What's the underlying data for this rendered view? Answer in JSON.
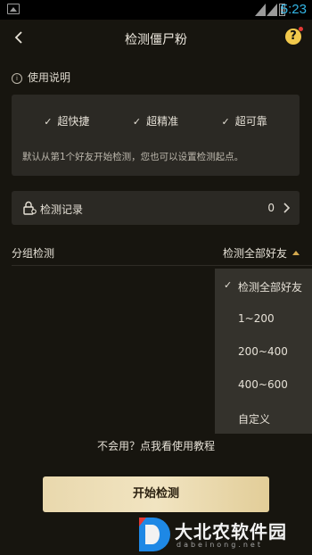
{
  "status_bar": {
    "time": "5:23"
  },
  "nav": {
    "title": "检测僵尸粉",
    "help": "?"
  },
  "instructions": {
    "heading": "使用说明",
    "features": [
      "超快捷",
      "超精准",
      "超可靠"
    ],
    "description": "默认从第1个好友开始检测，您也可以设置检测起点。"
  },
  "record": {
    "label": "检测记录",
    "count": "0"
  },
  "group": {
    "label": "分组检测",
    "selected": "检测全部好友"
  },
  "dropdown": {
    "options": [
      "检测全部好友",
      "1~200",
      "200~400",
      "400~600",
      "自定义"
    ],
    "selected_index": 0
  },
  "tutorial_link": "不会用？点我看使用教程",
  "start_button": "开始检测",
  "watermark": {
    "text": "大北农软件园",
    "url": "dabeinong.net"
  },
  "colors": {
    "background": "#17150f",
    "card": "#2b2924",
    "accent": "#d4a94e",
    "help": "#f2c94c"
  }
}
